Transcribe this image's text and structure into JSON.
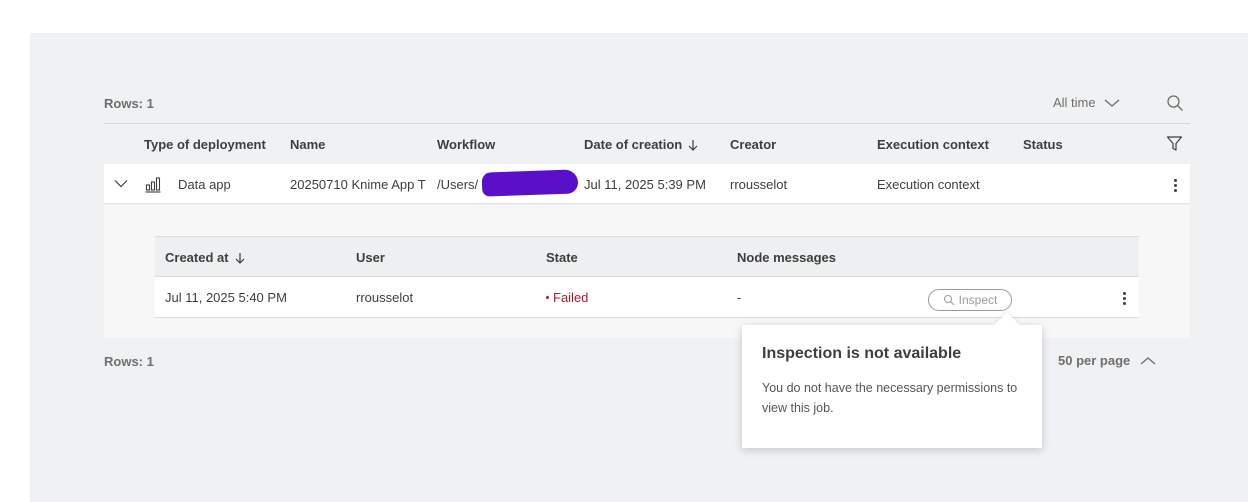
{
  "toolbar": {
    "rows_label": "Rows: 1",
    "time_filter": "All time"
  },
  "table": {
    "columns": [
      "Type of deployment",
      "Name",
      "Workflow",
      "Date of creation",
      "Creator",
      "Execution context",
      "Status"
    ],
    "row": {
      "type": "Data app",
      "name": "20250710 Knime App T",
      "workflow": "/Users/",
      "date": "Jul 11, 2025 5:39 PM",
      "creator": "rrousselot",
      "execution_context": "Execution context",
      "status": ""
    }
  },
  "jobs": {
    "columns": [
      "Created at",
      "User",
      "State",
      "Node messages"
    ],
    "row": {
      "created_at": "Jul 11, 2025 5:40 PM",
      "user": "rrousselot",
      "state": "Failed",
      "node_messages": "-",
      "inspect_label": "Inspect"
    }
  },
  "footer": {
    "rows_label": "Rows: 1",
    "per_page": "50 per page"
  },
  "tooltip": {
    "title": "Inspection is not available",
    "body": "You do not have the necessary permissions to view this job."
  },
  "colors": {
    "failed": "#b0192e",
    "background": "#f0f1f2",
    "scribble": "#5a10c8"
  }
}
